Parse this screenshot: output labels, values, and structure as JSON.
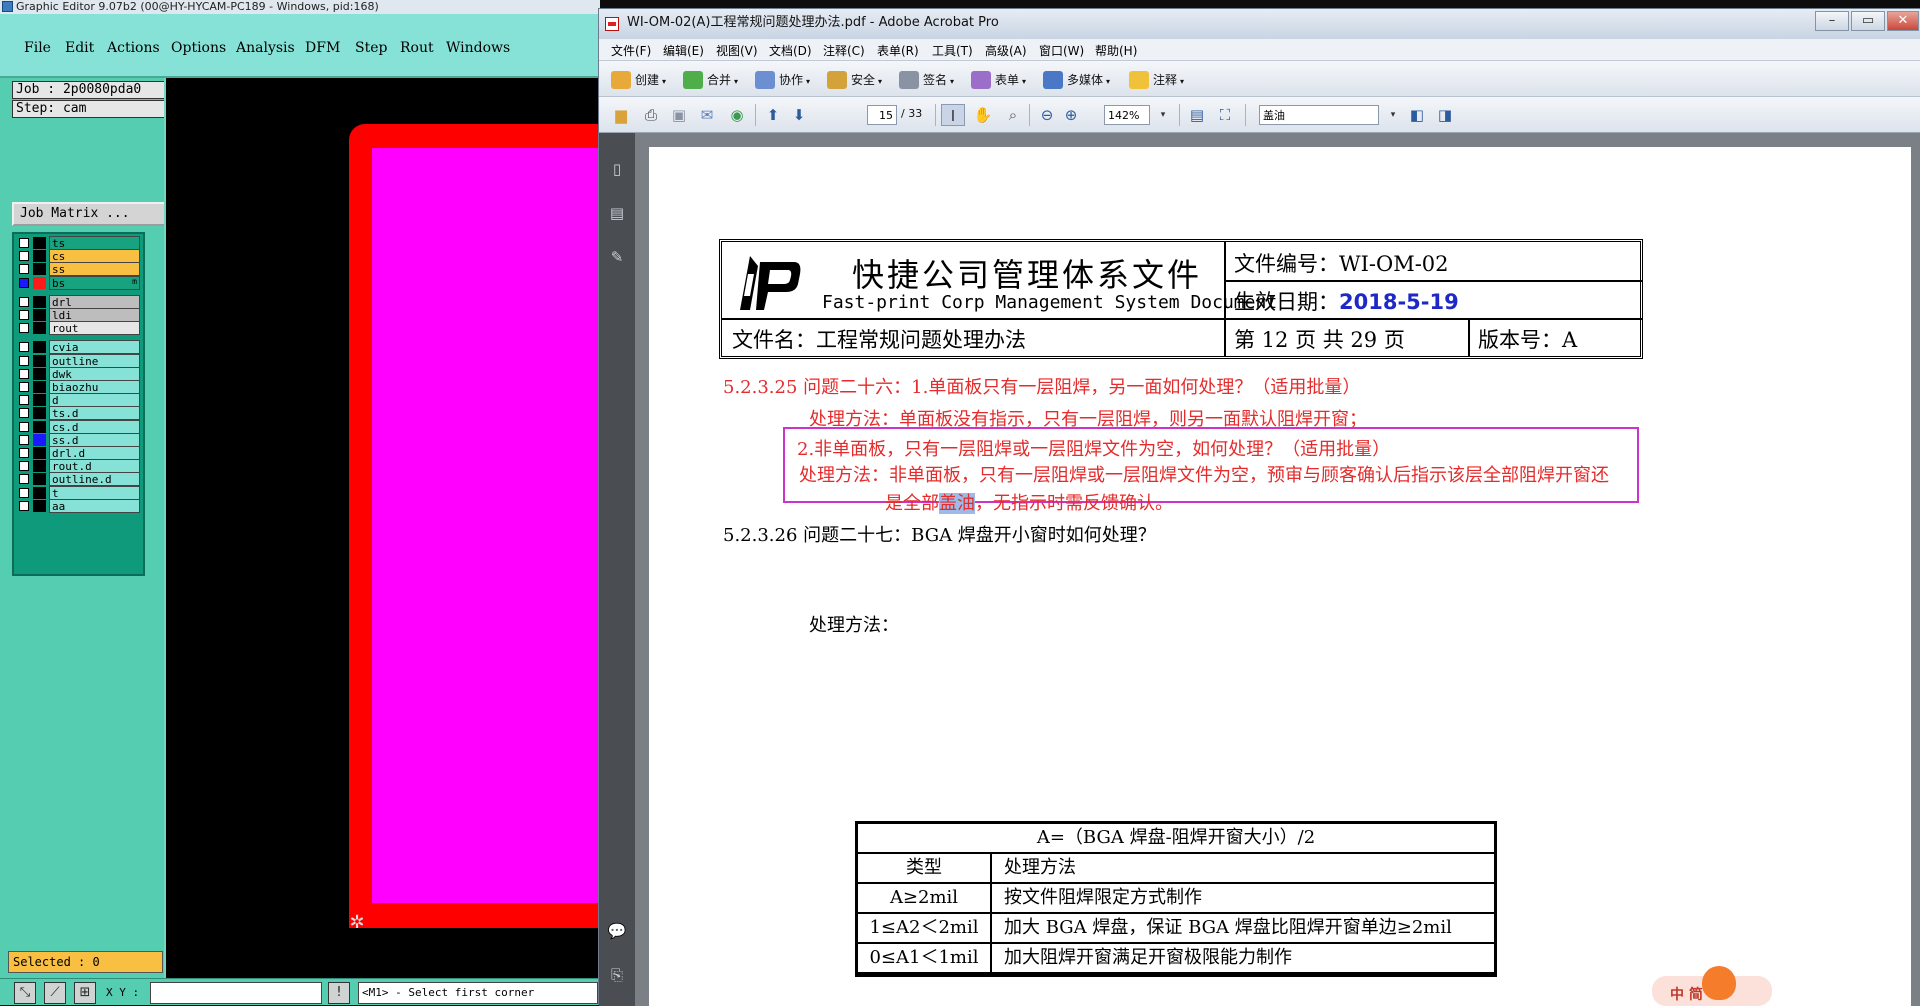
{
  "graphic_editor": {
    "title": "Graphic Editor 9.07b2 (00@HY-HYCAM-PC189 - Windows, pid:168)",
    "menu": [
      "File",
      "Edit",
      "Actions",
      "Options",
      "Analysis",
      "DFM",
      "Step",
      "Rout",
      "Windows"
    ],
    "job_label": "Job : 2p0080pda0",
    "step_label": "Step: cam",
    "job_matrix_button": "Job Matrix ...",
    "layers": [
      {
        "name": "ts",
        "color": "#17a37f",
        "swatch": "#000000"
      },
      {
        "name": "cs",
        "color": "#f9bf42",
        "swatch": "#000000"
      },
      {
        "name": "ss",
        "color": "#f9bf42",
        "swatch": "#000000"
      },
      {
        "name": "bs",
        "color": "#17a37f",
        "swatch": "#ff1a1a",
        "active": true,
        "mark": "m"
      },
      {
        "name": "drl",
        "color": "#bdbdbd",
        "swatch": "#000000"
      },
      {
        "name": "ldi",
        "color": "#bdbdbd",
        "swatch": "#000000"
      },
      {
        "name": "rout",
        "color": "#e6e6e6",
        "swatch": "#000000"
      },
      {
        "name": "cvia",
        "color": "#86e2d6",
        "swatch": "#000000"
      },
      {
        "name": "outline",
        "color": "#86e2d6",
        "swatch": "#000000"
      },
      {
        "name": "dwk",
        "color": "#86e2d6",
        "swatch": "#000000"
      },
      {
        "name": "biaozhu",
        "color": "#86e2d6",
        "swatch": "#000000"
      },
      {
        "name": "d",
        "color": "#86e2d6",
        "swatch": "#000000"
      },
      {
        "name": "ts.d",
        "color": "#86e2d6",
        "swatch": "#000000"
      },
      {
        "name": "cs.d",
        "color": "#86e2d6",
        "swatch": "#000000"
      },
      {
        "name": "ss.d",
        "color": "#86e2d6",
        "swatch": "#1a1aff"
      },
      {
        "name": "drl.d",
        "color": "#86e2d6",
        "swatch": "#000000"
      },
      {
        "name": "rout.d",
        "color": "#86e2d6",
        "swatch": "#000000"
      },
      {
        "name": "outline.d",
        "color": "#86e2d6",
        "swatch": "#000000"
      },
      {
        "name": "t",
        "color": "#86e2d6",
        "swatch": "#000000"
      },
      {
        "name": "aa",
        "color": "#86e2d6",
        "swatch": "#000000"
      }
    ],
    "selected_label": "Selected : 0",
    "xy_label": "X Y :",
    "xy_value": "",
    "prompt": "<M1> - Select first corner",
    "colors": {
      "board": "#ff0000",
      "area": "#ff00ff",
      "background": "#000000",
      "panel": "#55cdb1"
    }
  },
  "acrobat": {
    "title": "WI-OM-02(A)工程常规问题处理办法.pdf - Adobe Acrobat Pro",
    "window_buttons": [
      "minimize",
      "maximize",
      "close"
    ],
    "menu": [
      "文件(F)",
      "编辑(E)",
      "视图(V)",
      "文档(D)",
      "注释(C)",
      "表单(R)",
      "工具(T)",
      "高级(A)",
      "窗口(W)",
      "帮助(H)"
    ],
    "toolbar": [
      {
        "label": "创建",
        "icon": "create-icon"
      },
      {
        "label": "合并",
        "icon": "combine-icon"
      },
      {
        "label": "协作",
        "icon": "collaborate-icon"
      },
      {
        "label": "安全",
        "icon": "lock-icon"
      },
      {
        "label": "签名",
        "icon": "pen-icon"
      },
      {
        "label": "表单",
        "icon": "form-icon"
      },
      {
        "label": "多媒体",
        "icon": "multimedia-icon"
      },
      {
        "label": "注释",
        "icon": "comment-icon"
      }
    ],
    "nav": {
      "page": "15",
      "total": "/ 33",
      "zoom": "142%",
      "find": "盖油"
    },
    "document": {
      "header": {
        "title_zh": "快捷公司管理体系文件",
        "title_en": "Fast-print Corp Management System Document",
        "doc_no_label": "文件编号：WI-OM-02",
        "date_label": "生效日期：",
        "date_value": "2018-5-19",
        "doc_name": "文件名：工程常规问题处理办法",
        "page_info": "第 12 页 共 29 页",
        "version": "版本号：A"
      },
      "p1": "5.2.3.25  问题二十六：1.单面板只有一层阻焊，另一面如何处理？（适用批量）",
      "p2": "处理方法：单面板没有指示，只有一层阻焊，则另一面默认阻焊开窗；",
      "p3": "2.非单面板，只有一层阻焊或一层阻焊文件为空，如何处理？（适用批量）",
      "p4": "处理方法：非单面板，只有一层阻焊或一层阻焊文件为空，预审与顾客确认后指示该层全部阻焊开窗还",
      "p5_a": "是全部",
      "p5_sel": "盖油",
      "p5_b": "，无指示时需反馈确认。",
      "p6": "5.2.3.26  问题二十七：BGA 焊盘开小窗时如何处理？",
      "p7": "处理方法：",
      "table": {
        "title": "A=（BGA 焊盘-阻焊开窗大小）/2",
        "headers": [
          "类型",
          "处理方法"
        ],
        "rows": [
          [
            "A≥2mil",
            "按文件阻焊限定方式制作"
          ],
          [
            "1≤A2＜2mil",
            "加大 BGA 焊盘，保证 BGA 焊盘比阻焊开窗单边≥2mil"
          ],
          [
            "0≤A1＜1mil",
            "加大阻焊开窗满足开窗极限能力制作"
          ]
        ]
      }
    }
  },
  "ime": {
    "label": "中 简"
  }
}
